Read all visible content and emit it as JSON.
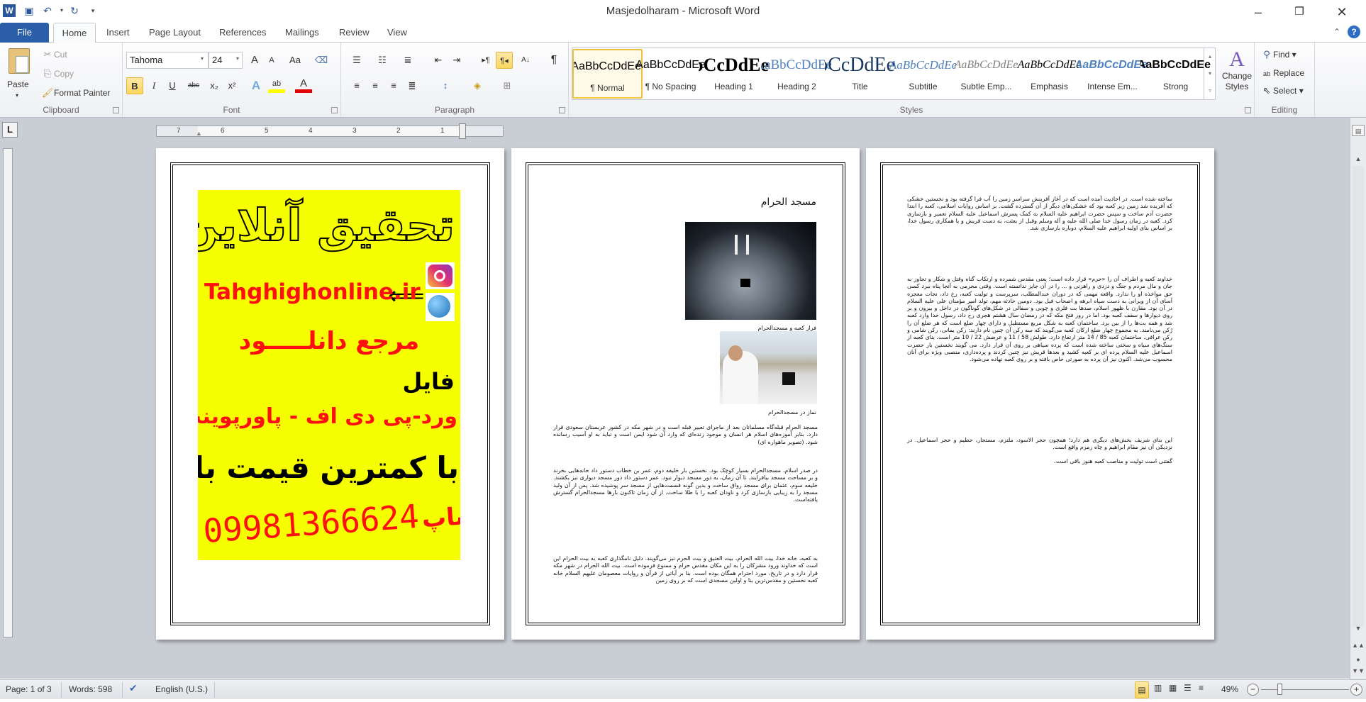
{
  "window": {
    "title": "Masjedolharam - Microsoft Word",
    "controls": {
      "minimize": "–",
      "restore": "❐",
      "close": "✕"
    }
  },
  "quick_access": {
    "save": "save-icon",
    "undo": "undo-icon",
    "redo": "redo-icon"
  },
  "tabs": [
    "File",
    "Home",
    "Insert",
    "Page Layout",
    "References",
    "Mailings",
    "Review",
    "View"
  ],
  "ribbon": {
    "clipboard": {
      "label": "Clipboard",
      "paste": "Paste",
      "cut": "Cut",
      "copy": "Copy",
      "format_painter": "Format Painter"
    },
    "font": {
      "label": "Font",
      "name": "Tahoma",
      "size": "24",
      "grow": "A",
      "shrink": "A",
      "change_case": "Aa",
      "bold": "B",
      "italic": "I",
      "underline": "U",
      "strike": "abc",
      "subscript": "x₂",
      "superscript": "x²",
      "highlight_color": "#ffff00",
      "font_color": "#e00000"
    },
    "paragraph": {
      "label": "Paragraph",
      "pilcrow": "¶"
    },
    "styles": {
      "label": "Styles",
      "items": [
        {
          "preview": "AaBbCcDdEe",
          "name": "¶ Normal",
          "active": true
        },
        {
          "preview": "AaBbCcDdEe",
          "name": "¶ No Spacing"
        },
        {
          "preview": "AaBbCcDdEe",
          "name": "Heading 1"
        },
        {
          "preview": "AaBbCcDdEe",
          "name": "Heading 2"
        },
        {
          "preview": "AaBbCcDdEe",
          "name": "Title"
        },
        {
          "preview": "AaBbCcDdEe",
          "name": "Subtitle"
        },
        {
          "preview": "AaBbCcDdEe",
          "name": "Subtle Emp..."
        },
        {
          "preview": "AaBbCcDdEe",
          "name": "Emphasis"
        },
        {
          "preview": "AaBbCcDdEe",
          "name": "Intense Em..."
        },
        {
          "preview": "AaBbCcDdEe",
          "name": "Strong"
        }
      ],
      "change_styles": "Change Styles"
    },
    "editing": {
      "label": "Editing",
      "find": "Find",
      "replace": "Replace",
      "select": "Select"
    }
  },
  "ruler": {
    "numbers": [
      "7",
      "6",
      "5",
      "4",
      "3",
      "2",
      "1"
    ]
  },
  "pages": {
    "page1": {
      "ad": {
        "title": "تحقیق آنلاین",
        "site": "Tahghighonline.ir",
        "line1": "مرجع دانلـــــود",
        "line2": "فایل",
        "line3": "ورد-پی دی اف - پاورپوینت",
        "line4": "با کمترین قیمت بازار",
        "phone": "09981366624",
        "whatsapp": "واتساپ",
        "bg_color": "#f5ff00",
        "red": "#ff1010"
      }
    },
    "page2": {
      "heading": "مسجد الحرام",
      "caption1": "فراز کعبه و مسجدالحرام",
      "caption2": "نماز در مسجدالحرام",
      "paragraphs": [
        "مسجد الحرام قبله‌گاه مسلمانان بعد از ماجرای تغییر قبله است و در شهر مکه در کشور عربستان سعودی قرار دارد. بنابر آموزه‌های اسلام هر انسان و موجود زنده‌ای که وارد آن شود ایمن است و نباید به او آسیب رسانده شود. (تصویر ماهواره ای)",
        "در صدر اسلام، مسجدالحرام بسیار کوچک بود. نخستین بار خلیفه دوم، عمر بن خطاب دستور داد خانه‌هایی بخرند و بر مساحت مسجد بیافزایند. تا آن زمان، به دور مسجد دیوار نبود. عمر دستور داد دور مسجد دیواری نیز بکشند. خلیفه سوم، عثمان برای مسجد رواق ساخت و بدین گونه قسمت‌هایی از مسجد سر پوشیده شد. پس از آن ولید مسجد را به زیبایی بازسازی کرد و ناودان کعبه را با طلا ساخت. از آن زمان تاکنون بارها مسجدالحرام گسترش یافته‌است.",
        "به کعبه، خانه خدا، بیت الله الحرام، بیت العتیق و بیت الحرم نیز می‌گویند. دلیل نامگذاری کعبه به بیت الحرام این است که خداوند ورود مشرکان را به این مکان مقدس حرام و ممنوع فرموده است. بیت الله الحرام در شهر مکه قرار دارد و در تاریخ، مورد احترام همگان بوده است. بنا بر آیاتی از قرآن و روایات معصومان علیهم السلام خانه کعبه نخستین و مقدس‌ترین بنا و اولین مسجدی است که بر روی زمین"
      ]
    },
    "page3": {
      "paragraphs": [
        "ساخته شده است. در احادیث آمده است که در آغاز آفرینش سراسر زمین را آب فرا گرفته بود و نخستین خشکی که آفریده شد زمین زیر کعبه بود که خشکی‌های دیگر از آن گسترده گشت. بر اساس روایات اسلامی، کعبه را ابتدا حضرت آدم ساخت و سپس حضرت ابراهیم علیه السلام به کمک پسرش اسماعیل علیه السلام تعمیر و بازسازی کرد. کعبه در زمان رسول خدا صلی الله علیه و آله وسلم وقبل از بعثت، به دست قریش و یا همکاری رسول خدا، بر اساس بنای اولیه ابراهیم علیه السلام، دوباره بازسازی شد.",
        "خداوند کعبه و اطراف آن را «حرم» قرار داده است؛ یعنی مقدس شمرده و ارتکاب گناه وقتل و شکار و تجاوز به جان و مال مردم و جنگ و دزدی و راهزنی و ... را در آن جایز ندانسته است. وقتی مجرمی به آنجا پناه ببرد کسی حق مواخذه او را ندارد. واقعه مهمی که در دوران عبدالمطلب، سرپرست و تولیت کعبه، رخ داد، نجات معجزه آسای آن از ویرانی به دست سپاه ابرهه و اصحاب فیل بود. دومین حادثه مهم، تولد امیر مؤمنان علی علیه السلام در آن بود. مقارن با ظهور اسلام، صدها بت فلزی و چوبی و سفالی در شکل‌های گوناگون در داخل و بیرون و بر روی دیوارها و سقف کعبه بود. اما در روز فتح مکه که در رمضان سال هشتم هجری رخ داد، رسول خدا وارد کعبه شد و همه بت‌ها را از بین برد. ساختمان کعبه به شکل مربع مستطیل و دارای چهار ضلع است که هر ضلع آن را رُکن می‌نامند. به مجموع چهار ضلع ارکان کعبه می‌گویند که سه رکن آن چنین نام دارند: رکن یمانی، رکن شامی و رکن عراقی. ساختمان کعبه 85 / 14 متر ارتفاع دارد. طولش 58 / 11 و عرضش 22 / 10 متر است. بنای کعبه از سنگ‌های سیاه و سختی ساخته شده است که پرده سیاهی بر روی آن قرار دارد. می گویند نخستین بار حضرت اسماعیل علیه السلام پرده ای بر کعبه کشید و بعدها قریش نیز چنین کردند و پرده‌داری، منصبی ویژه برای آنان محسوب می‌شد. اکنون نیز آن پرده به صورتی خاص بافته و بر روی کعبه نهاده می‌شود.",
        "این بنای شریف بخش‌های دیگری هم دارد؛ همچون حجر الاسود، ملتزم، مستجار، حطیم و حجر اسماعیل. در نزدیکی آن نیز مقام ابراهیم و چاه زمزم واقع است.",
        "گفتنی است تولیت و مناصب کعبه هنوز باقی است."
      ]
    }
  },
  "status": {
    "page": "Page: 1 of 3",
    "words": "Words: 598",
    "language": "English (U.S.)",
    "zoom": "49%",
    "zoom_out": "−",
    "zoom_in": "+",
    "zoom_level_percent": 49
  }
}
